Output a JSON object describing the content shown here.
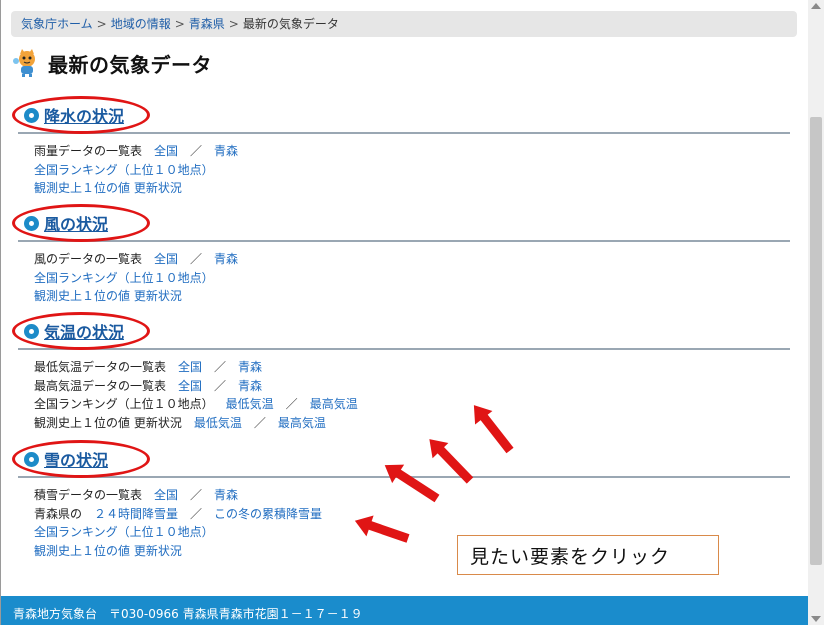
{
  "breadcrumb": {
    "items": [
      {
        "label": "気象庁ホーム"
      },
      {
        "label": "地域の情報"
      },
      {
        "label": "青森県"
      },
      {
        "label": "最新の気象データ"
      }
    ],
    "separator": ">"
  },
  "page_title": "最新の気象データ",
  "sections": [
    {
      "title": "降水の状況",
      "rows": [
        {
          "label": "雨量データの一覧表",
          "link1": "全国",
          "sep": "／",
          "link2": "青森"
        },
        {
          "link": "全国ランキング（上位１０地点）"
        },
        {
          "link1": "観測史上１位の値",
          "link2": "更新状況"
        }
      ]
    },
    {
      "title": "風の状況",
      "rows": [
        {
          "label": "風のデータの一覧表",
          "link1": "全国",
          "sep": "／",
          "link2": "青森"
        },
        {
          "link": "全国ランキング（上位１０地点）"
        },
        {
          "link1": "観測史上１位の値",
          "link2": "更新状況"
        }
      ]
    },
    {
      "title": "気温の状況",
      "rows": [
        {
          "label": "最低気温データの一覧表",
          "link1": "全国",
          "sep": "／",
          "link2": "青森"
        },
        {
          "label": "最高気温データの一覧表",
          "link1": "全国",
          "sep": "／",
          "link2": "青森"
        },
        {
          "label": "全国ランキング（上位１０地点）",
          "link1": "最低気温",
          "sep": "／",
          "link2": "最高気温"
        },
        {
          "label": "観測史上１位の値 更新状況",
          "link1": "最低気温",
          "sep": "／",
          "link2": "最高気温"
        }
      ]
    },
    {
      "title": "雪の状況",
      "rows": [
        {
          "label": "積雪データの一覧表",
          "link1": "全国",
          "sep": "／",
          "link2": "青森"
        },
        {
          "label": "青森県の",
          "link1": "２４時間降雪量",
          "sep": "／",
          "link2": "この冬の累積降雪量"
        },
        {
          "link": "全国ランキング（上位１０地点）"
        },
        {
          "link1": "観測史上１位の値",
          "link2": "更新状況"
        }
      ]
    }
  ],
  "callout": "見たい要素をクリック",
  "footer": "青森地方気象台　〒030-0966 青森県青森市花園１－１７－１９",
  "colors": {
    "link": "#1f6cc0",
    "section_title": "#1a5aa0",
    "annotation_red": "#e01515",
    "footer_bg": "#1a8ccc",
    "callout_border": "#d98a4a"
  }
}
